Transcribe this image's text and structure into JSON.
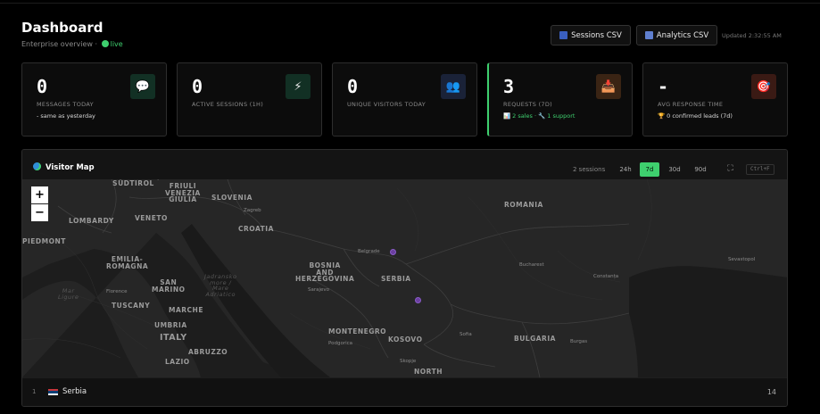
{
  "header": {
    "title": "Dashboard",
    "subtitle_prefix": "Enterprise overview ·",
    "live_label": "live",
    "buttons": [
      {
        "label": "Sessions CSV",
        "icon": "bar-chart-icon"
      },
      {
        "label": "Analytics CSV",
        "icon": "line-chart-icon"
      }
    ],
    "updated": "Updated 2:32:55 AM"
  },
  "stats": [
    {
      "value": "0",
      "label": "MESSAGES TODAY",
      "sub": "- same as yesterday",
      "icon": "💬",
      "icon_name": "chat-icon",
      "icon_bg": "#123024"
    },
    {
      "value": "0",
      "label": "ACTIVE SESSIONS (1H)",
      "sub": "",
      "icon": "⚡",
      "icon_name": "lightning-icon",
      "icon_bg": "#123024"
    },
    {
      "value": "0",
      "label": "UNIQUE VISITORS TODAY",
      "sub": "",
      "icon": "👥",
      "icon_name": "users-icon",
      "icon_bg": "#1a2238"
    },
    {
      "value": "3",
      "label": "REQUESTS (7D)",
      "sub": "📊 2 sales · 🔧 1 support",
      "icon": "📥",
      "icon_name": "inbox-icon",
      "icon_bg": "#3a2414"
    },
    {
      "value": "-",
      "label": "AVG RESPONSE TIME",
      "sub": "🏆 0 confirmed leads (7d)",
      "icon": "🎯",
      "icon_name": "target-icon",
      "icon_bg": "#3a1a14"
    }
  ],
  "map": {
    "title": "Visitor Map",
    "sessions": "2 sessions",
    "ranges": [
      "24h",
      "7d",
      "30d",
      "90d"
    ],
    "active_range": "7d",
    "shortcut": "Ctrl+F",
    "zoom_in": "+",
    "zoom_out": "−",
    "labels": {
      "trentino": "TRENTINO-\nALTO ADIGE /\nSÜDTIROL",
      "friuli": "FRIULI\nVENEZIA\nGIULIA",
      "slovenia": "SLOVENIA",
      "zagreb": "Zagreb",
      "lombardy": "LOMBARDY",
      "veneto": "VENETO",
      "croatia": "CROATIA",
      "piedmont": "PIEDMONT",
      "emilia": "EMILIA-\nROMAGNA",
      "marliguria": "Mar\nLigure",
      "florence": "Florence",
      "sanmarino": "SAN\nMARINO",
      "tuscany": "TUSCANY",
      "marche": "MARCHE",
      "umbria": "UMBRIA",
      "italy": "ITALY",
      "lazio": "LAZIO",
      "abruzzo": "ABRUZZO",
      "mareadriatico": "Jadransko\nmore /\nMare\nAdriatico",
      "bosnia": "BOSNIA\nAND\nHERZEGOVINA",
      "sarajevo": "Sarajevo",
      "belgrade": "Belgrade",
      "serbia": "SERBIA",
      "montenegro": "MONTENEGRO",
      "podgorica": "Podgorica",
      "kosovo": "KOSOVO",
      "skopje": "Skopje",
      "north": "NORTH",
      "romania": "ROMANIA",
      "bucharest": "Bucharest",
      "constanta": "Constanța",
      "sevastopol": "Sevastopol",
      "sofia": "Sofia",
      "bulgaria": "BULGARIA",
      "burgas": "Burgas"
    },
    "markers": [
      "Belgrade",
      "Serbia"
    ]
  },
  "table": {
    "rows": [
      {
        "rank": "1",
        "country": "Serbia",
        "count": "14"
      }
    ]
  }
}
